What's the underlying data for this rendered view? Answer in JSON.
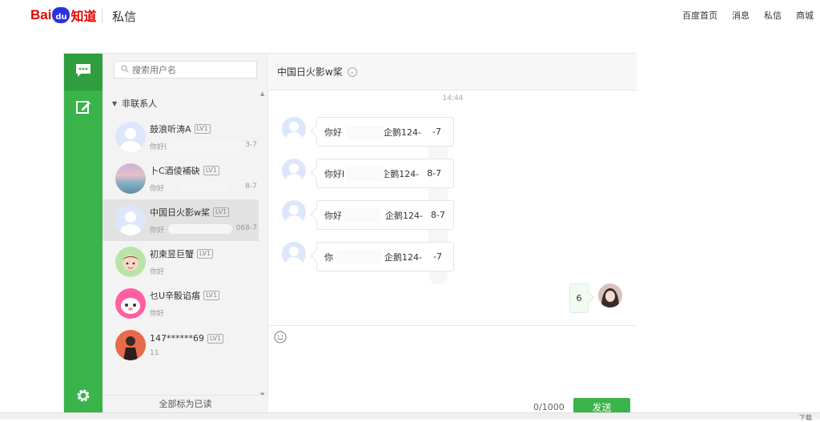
{
  "header": {
    "logo_bai": "Bai",
    "logo_du": "du",
    "logo_zhidao": "知道",
    "title": "私信",
    "nav": [
      "百度首页",
      "消息",
      "私信",
      "商城"
    ]
  },
  "sidebar": {
    "icons": [
      "chat-bubble-icon",
      "compose-icon",
      "settings-gear-icon"
    ],
    "accent": "#3ab34a"
  },
  "contacts": {
    "search_placeholder": "搜索用户名",
    "group_label": "非联系人",
    "mark_all_read": "全部标为已读",
    "items": [
      {
        "name": "鼓浪听涛A",
        "level": "LV1",
        "preview_start": "你好(",
        "preview_end": "3-7",
        "avatar": "default"
      },
      {
        "name": "卜C酒倰補砄",
        "level": "LV1",
        "preview_start": "你好",
        "preview_end": "8-7",
        "avatar": "sunset"
      },
      {
        "name": "中国日火影w桨",
        "level": "LV1",
        "preview_start": "你好",
        "preview_end": "068-7",
        "avatar": "default"
      },
      {
        "name": "初柬昱巨蟹",
        "level": "LV1",
        "preview_start": "你好",
        "preview_end": "",
        "avatar": "girl"
      },
      {
        "name": "乜U辛骰谄痦",
        "level": "LV1",
        "preview_start": "你好",
        "preview_end": "",
        "avatar": "pink"
      },
      {
        "name": "147******69",
        "level": "LV1",
        "preview_start": "11",
        "preview_end": "",
        "avatar": "figure"
      }
    ]
  },
  "chat": {
    "title": "中国日火影w桨",
    "timestamp": "14:44",
    "messages": [
      {
        "start": "你好",
        "end": "企鹅124-",
        "tail": "-7"
      },
      {
        "start": "你好I",
        "end": "企鹅124-",
        "tail": "8-7"
      },
      {
        "start": "你好",
        "end": "企鹅124-",
        "tail": "8-7"
      },
      {
        "start": "你",
        "end": "企鹅124-",
        "tail": "-7"
      }
    ],
    "own_message": "6",
    "counter": "0/1000",
    "send_label": "发送"
  },
  "footer": {
    "items": [
      "下载"
    ]
  }
}
